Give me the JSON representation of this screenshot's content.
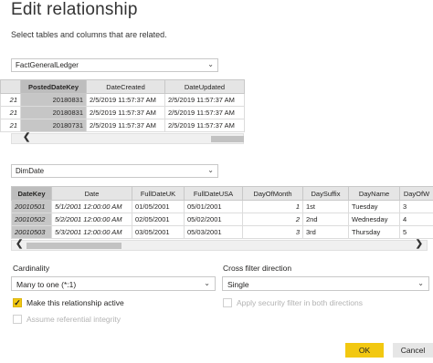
{
  "dialog": {
    "title": "Edit relationship",
    "subtitle": "Select tables and columns that are related."
  },
  "table1": {
    "name": "FactGeneralLedger",
    "chevron": "⌄",
    "columns": [
      "PostedDateKey",
      "DateCreated",
      "DateUpdated"
    ],
    "partial_col": "21",
    "rows": [
      [
        "20180831",
        "2/5/2019 11:57:37 AM",
        "2/5/2019 11:57:37 AM"
      ],
      [
        "20180831",
        "2/5/2019 11:57:37 AM",
        "2/5/2019 11:57:37 AM"
      ],
      [
        "20180731",
        "2/5/2019 11:57:37 AM",
        "2/5/2019 11:57:37 AM"
      ]
    ],
    "scroll_left": "❮"
  },
  "table2": {
    "name": "DimDate",
    "chevron": "⌄",
    "columns": [
      "DateKey",
      "Date",
      "FullDateUK",
      "FullDateUSA",
      "DayOfMonth",
      "DaySuffix",
      "DayName",
      "DayOfW"
    ],
    "rows": [
      [
        "20010501",
        "5/1/2001 12:00:00 AM",
        "01/05/2001",
        "05/01/2001",
        "1",
        "1st",
        "Tuesday",
        "3"
      ],
      [
        "20010502",
        "5/2/2001 12:00:00 AM",
        "02/05/2001",
        "05/02/2001",
        "2",
        "2nd",
        "Wednesday",
        "4"
      ],
      [
        "20010503",
        "5/3/2001 12:00:00 AM",
        "03/05/2001",
        "05/03/2001",
        "3",
        "3rd",
        "Thursday",
        "5"
      ]
    ],
    "scroll_left": "❮",
    "scroll_right": "❯"
  },
  "cardinality": {
    "label": "Cardinality",
    "value": "Many to one (*:1)",
    "chevron": "⌄"
  },
  "cross_filter": {
    "label": "Cross filter direction",
    "value": "Single",
    "chevron": "⌄"
  },
  "options": {
    "active_label": "Make this relationship active",
    "active_check": "✓",
    "integrity_label": "Assume referential integrity",
    "security_label": "Apply security filter in both directions"
  },
  "buttons": {
    "ok": "OK",
    "cancel": "Cancel"
  },
  "colors": {
    "accent": "#f2c811",
    "selected_column": "#c6c6c6"
  }
}
